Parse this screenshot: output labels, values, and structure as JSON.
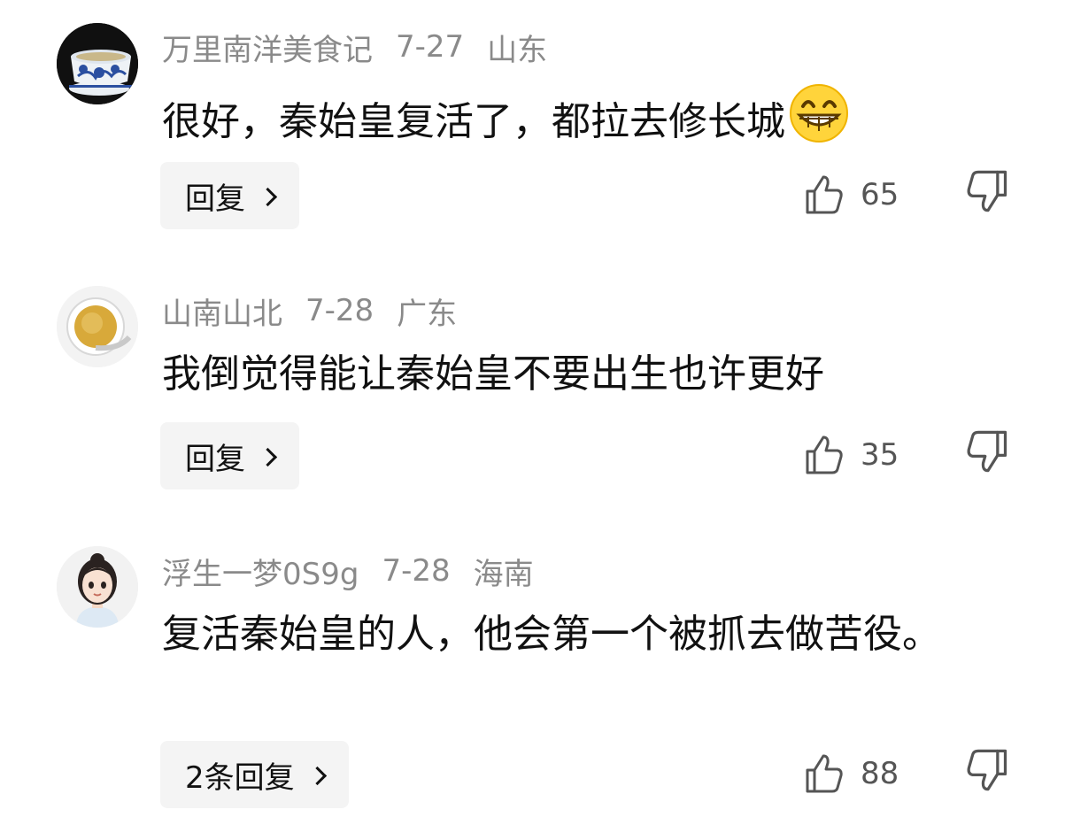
{
  "comments": [
    {
      "username": "万里南洋美食记",
      "date": "7-27",
      "location": "山东",
      "text": "很好，秦始皇复活了，都拉去修长城",
      "emoji": "grinning-face-emoji",
      "reply_label": "回复",
      "likes": "65",
      "avatar": "blue-white-porcelain-teacup"
    },
    {
      "username": "山南山北",
      "date": "7-28",
      "location": "广东",
      "text": "我倒觉得能让秦始皇不要出生也许更好",
      "reply_label": "回复",
      "likes": "35",
      "avatar": "cup-of-tea"
    },
    {
      "username": "浮生一梦0S9g",
      "date": "7-28",
      "location": "海南",
      "text": "复活秦始皇的人，他会第一个被抓去做苦役。",
      "reply_label": "2条回复",
      "likes": "88",
      "avatar": "cartoon-girl"
    }
  ],
  "colors": {
    "meta": "#8a8a8a",
    "text": "#111111",
    "button_bg": "#f4f4f4",
    "icon": "#555555"
  },
  "icons": {
    "like": "thumbs-up-icon",
    "dislike": "thumbs-down-icon",
    "chevron": "chevron-right-icon"
  }
}
